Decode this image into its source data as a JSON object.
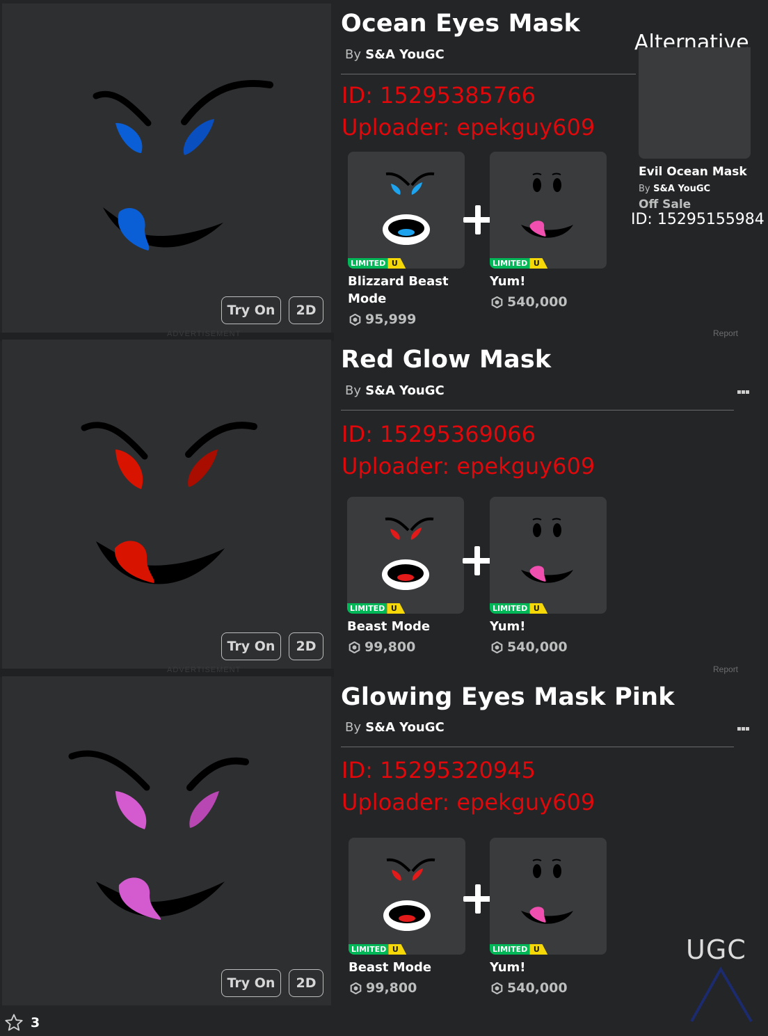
{
  "preview_buttons": {
    "try_on": "Try On",
    "two_d": "2D"
  },
  "ad_label": "ADVERTISEMENT",
  "report_label": "Report",
  "colors": {
    "id_text": "#e0080b",
    "limited_green": "#02b757",
    "limited_yellow": "#f6d809",
    "background": "#232527",
    "card": "#393b3d"
  },
  "items": [
    {
      "title": "Ocean Eyes Mask",
      "by": "By",
      "creator": "S&A YouGC",
      "id_line": "ID: 15295385766",
      "uploader_line": "Uploader: epekguy609",
      "accent": "#0a5fd6",
      "components": [
        {
          "name": "Blizzard Beast Mode",
          "price": "95,999",
          "badge": "LIMITED",
          "badge_u": "U",
          "accent": "#1ea4ef"
        },
        {
          "name": "Yum!",
          "price": "540,000",
          "badge": "LIMITED",
          "badge_u": "U",
          "accent": "#f14fb0"
        }
      ]
    },
    {
      "title": "Red Glow Mask",
      "by": "By",
      "creator": "S&A YouGC",
      "id_line": "ID: 15295369066",
      "uploader_line": "Uploader: epekguy609",
      "accent": "#d81300",
      "components": [
        {
          "name": "Beast Mode",
          "price": "99,800",
          "badge": "LIMITED",
          "badge_u": "U",
          "accent": "#e21a1a"
        },
        {
          "name": "Yum!",
          "price": "540,000",
          "badge": "LIMITED",
          "badge_u": "U",
          "accent": "#f14fb0"
        }
      ]
    },
    {
      "title": "Glowing Eyes Mask Pink",
      "by": "By",
      "creator": "S&A YouGC",
      "id_line": "ID: 15295320945",
      "uploader_line": "Uploader: epekguy609",
      "accent": "#d45ad0",
      "components": [
        {
          "name": "Beast Mode",
          "price": "99,800",
          "badge": "LIMITED",
          "badge_u": "U",
          "accent": "#e21a1a"
        },
        {
          "name": "Yum!",
          "price": "540,000",
          "badge": "LIMITED",
          "badge_u": "U",
          "accent": "#f14fb0"
        }
      ]
    }
  ],
  "alternative": {
    "label": "Alternative",
    "name": "Evil Ocean Mask",
    "by": "By",
    "creator": "S&A YouGC",
    "status": "Off Sale",
    "id_line": "ID: 15295155984"
  },
  "favorites": {
    "count": "3"
  },
  "watermark": {
    "text": "UGC"
  }
}
